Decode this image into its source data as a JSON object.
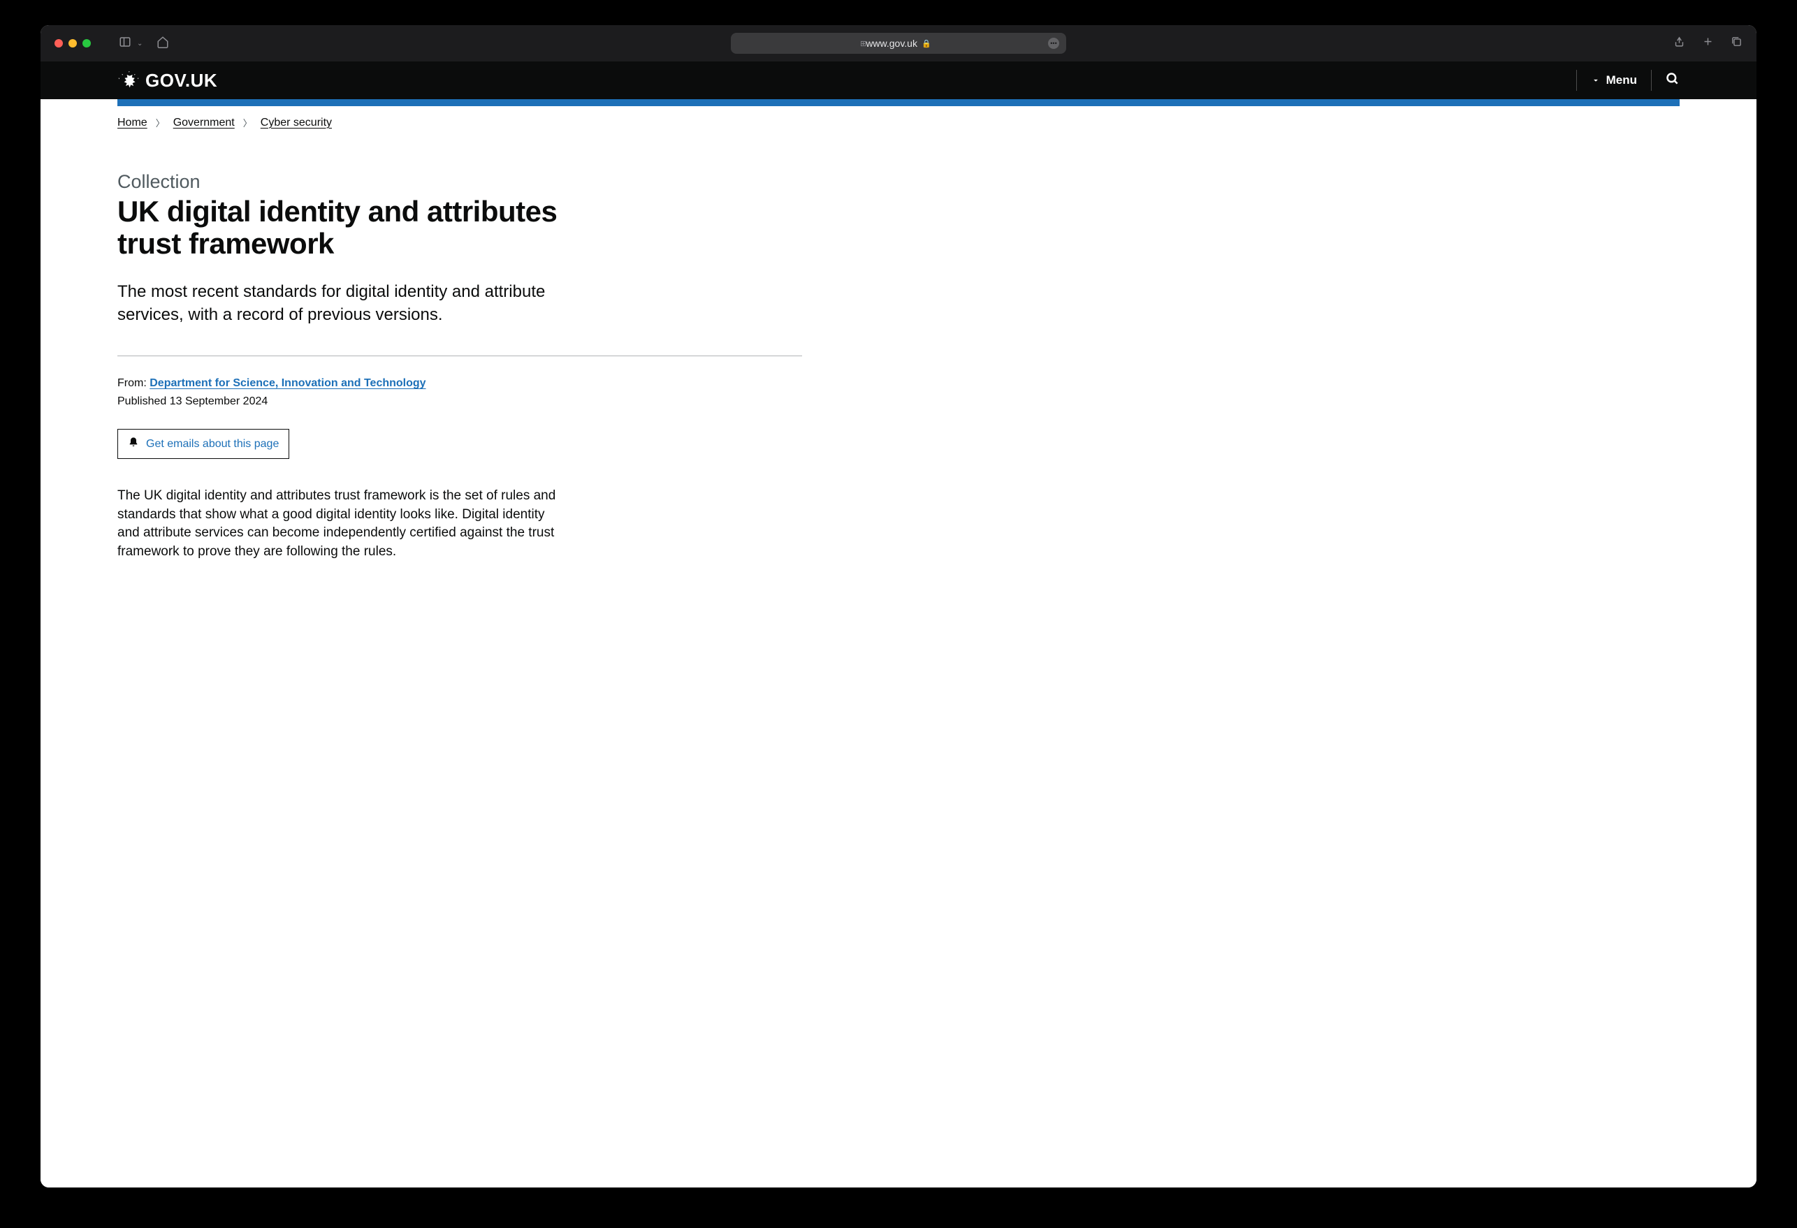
{
  "browser": {
    "url": "www.gov.uk"
  },
  "header": {
    "logo_text": "GOV.UK",
    "menu_label": "Menu"
  },
  "breadcrumbs": [
    {
      "label": "Home"
    },
    {
      "label": "Government"
    },
    {
      "label": "Cyber security"
    }
  ],
  "page": {
    "caption": "Collection",
    "title": "UK digital identity and attributes trust framework",
    "description": "The most recent standards for digital identity and attribute services, with a record of previous versions.",
    "from_label": "From:",
    "from_link": "Department for Science, Innovation and Technology",
    "published": "Published 13 September 2024",
    "email_button": "Get emails about this page",
    "body": "The UK digital identity and attributes trust framework is the set of rules and standards that show what a good digital identity looks like. Digital identity and attribute services can become independently certified against the trust framework to prove they are following the rules."
  }
}
